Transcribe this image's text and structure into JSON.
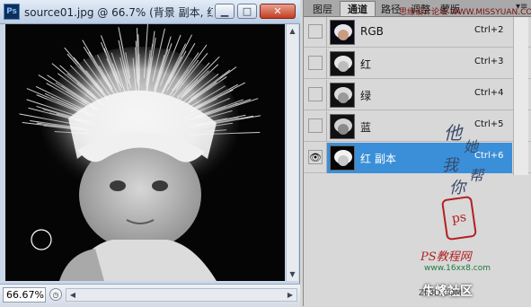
{
  "window": {
    "app_icon": "Ps",
    "title": "source01.jpg @ 66.7% (背景 副本, 红...",
    "min_label": "▁",
    "max_label": "□",
    "close_label": "✕"
  },
  "status": {
    "zoom": "66.67%"
  },
  "panel": {
    "tabs": [
      "图层",
      "通道",
      "路径",
      "调整",
      "蒙版"
    ],
    "top_watermark": "思缘设计论坛 WWW.MISSYUAN.COM",
    "channels": [
      {
        "name": "RGB",
        "shortcut": "Ctrl+2",
        "visible": false,
        "active": false
      },
      {
        "name": "红",
        "shortcut": "Ctrl+3",
        "visible": false,
        "active": false
      },
      {
        "name": "绿",
        "shortcut": "Ctrl+4",
        "visible": false,
        "active": false
      },
      {
        "name": "蓝",
        "shortcut": "Ctrl+5",
        "visible": false,
        "active": false
      },
      {
        "name": "红 副本",
        "shortcut": "Ctrl+6",
        "visible": true,
        "active": true
      }
    ]
  },
  "watermarks": {
    "calligraphy_1": "他",
    "calligraphy_2": "她",
    "calligraphy_3": "我",
    "calligraphy_4": "帮",
    "calligraphy_5": "你",
    "seal": "ps",
    "ps_site": "PS教程网",
    "ps_url": "www.16xx8.com",
    "community": "朱峰社区",
    "community_sub": "ZF3D.COM"
  },
  "colors": {
    "active_row": "#3a8fd8",
    "seal_red": "#b42020"
  }
}
